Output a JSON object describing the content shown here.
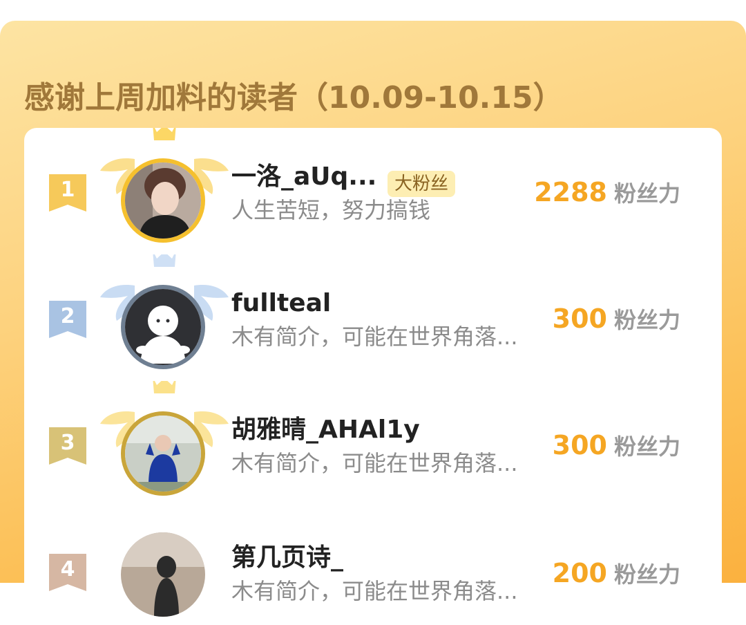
{
  "header": {
    "title": "感谢上周加料的读者（10.09-10.15）"
  },
  "rankings": [
    {
      "rank": "1",
      "name": "一洛_aUq...",
      "badge": "大粉丝",
      "bio": "人生苦短，努力搞钱",
      "score": "2288",
      "unit": "粉丝力",
      "rank_color": "#f6c95a",
      "frame_color": "#f5c02e"
    },
    {
      "rank": "2",
      "name": "fullteal",
      "bio": "木有简介，可能在世界角落...",
      "score": "300",
      "unit": "粉丝力",
      "rank_color": "#a9c3e3",
      "frame_color": "#6f7f92"
    },
    {
      "rank": "3",
      "name": "胡雅晴_AHAl1y",
      "bio": "木有简介，可能在世界角落...",
      "score": "300",
      "unit": "粉丝力",
      "rank_color": "#d8c277",
      "frame_color": "#c9a53a"
    },
    {
      "rank": "4",
      "name": "第几页诗_",
      "bio": "木有简介，可能在世界角落...",
      "score": "200",
      "unit": "粉丝力",
      "rank_color": "#d6b7a3",
      "frame_color": "#d8d8d8"
    }
  ]
}
